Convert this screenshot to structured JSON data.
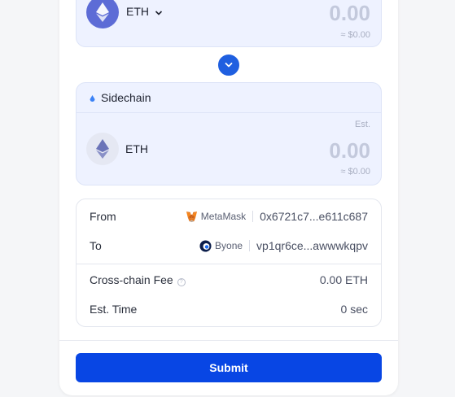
{
  "from_token": {
    "symbol": "ETH",
    "amount": "0.00",
    "usd": "≈ $0.00",
    "icon": "ethereum-icon"
  },
  "swap_icon": "chevron-down-icon",
  "to_token": {
    "chain": "Sidechain",
    "symbol": "ETH",
    "est_label": "Est.",
    "amount": "0.00",
    "usd": "≈ $0.00",
    "icon": "ethereum-icon"
  },
  "details": {
    "from_label": "From",
    "from_wallet": "MetaMask",
    "from_address": "0x6721c7...e611c687",
    "to_label": "To",
    "to_wallet": "Byone",
    "to_address": "vp1qr6ce...awwwkqpv",
    "fee_label": "Cross-chain Fee",
    "fee_value": "0.00 ETH",
    "time_label": "Est. Time",
    "time_value": "0 sec"
  },
  "submit_label": "Submit",
  "colors": {
    "accent": "#0846e4",
    "panel_bg": "#eef2ff",
    "eth_icon": "#5d6cd6"
  }
}
